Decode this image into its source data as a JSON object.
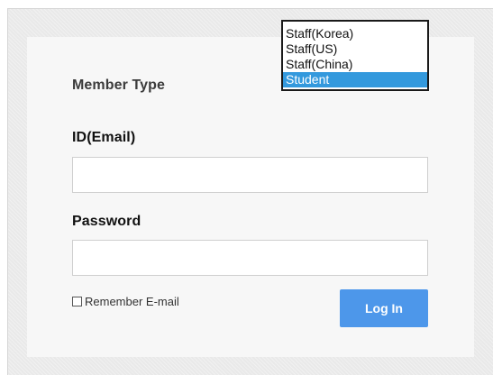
{
  "form": {
    "member_type_label": "Member Type",
    "member_type_options": [
      "Staff(Korea)",
      "Staff(US)",
      "Staff(China)",
      "Student"
    ],
    "member_type_selected": "Student",
    "id_label": "ID(Email)",
    "id_value": "",
    "password_label": "Password",
    "password_value": "",
    "remember_label": "Remember E-mail",
    "remember_checked": false,
    "login_label": "Log In"
  },
  "colors": {
    "login_button": "#4d97ea",
    "selected_option": "#3399dd"
  }
}
